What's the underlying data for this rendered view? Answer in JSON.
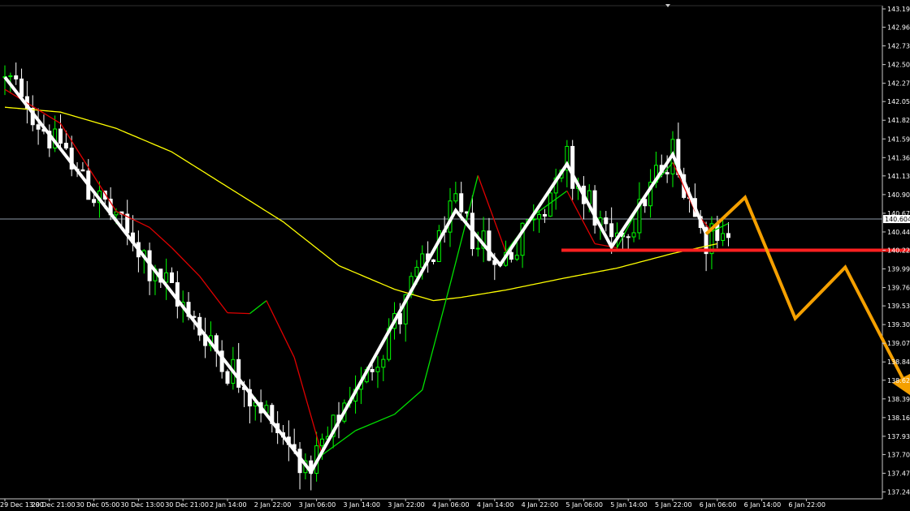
{
  "colors": {
    "background": "#000000",
    "frame": "#c8c8c8",
    "candle_up": "#00ff00",
    "candle_down": "#ffffff",
    "ma_slow": "#ffff00",
    "ma_fast_up": "#00e000",
    "ma_fast_down": "#e00000",
    "zigzag": "#ffffff",
    "neckline": "#ff2020",
    "projection": "#f5a000",
    "price_line": "#8e9aa8"
  },
  "chart_data": {
    "type": "candlestick",
    "title": "",
    "xlabel": "",
    "ylabel": "",
    "ylim": [
      137.16,
      143.23
    ],
    "grid": false,
    "y_ticks": [
      "143.190",
      "142.965",
      "142.735",
      "142.505",
      "142.275",
      "142.050",
      "141.820",
      "141.590",
      "141.360",
      "141.135",
      "140.905",
      "140.675",
      "140.445",
      "140.220",
      "139.990",
      "139.760",
      "139.535",
      "139.305",
      "139.075",
      "138.845",
      "138.620",
      "138.390",
      "138.160",
      "137.930",
      "137.705",
      "137.475",
      "137.245"
    ],
    "x_ticks": [
      "29 Dec 13:00",
      "29 Dec 21:00",
      "30 Dec 05:00",
      "30 Dec 13:00",
      "30 Dec 21:00",
      "2 Jan 14:00",
      "2 Jan 22:00",
      "3 Jan 06:00",
      "3 Jan 14:00",
      "3 Jan 22:00",
      "4 Jan 06:00",
      "4 Jan 14:00",
      "4 Jan 22:00",
      "5 Jan 06:00",
      "5 Jan 14:00",
      "5 Jan 22:00",
      "6 Jan 06:00",
      "6 Jan 14:00",
      "6 Jan 22:00"
    ],
    "current_price": "140.604",
    "neckline_price": 140.22,
    "zigzag_pivots": [
      {
        "bar": 0,
        "price": 142.35
      },
      {
        "bar": 55,
        "price": 137.49
      },
      {
        "bar": 81,
        "price": 140.71
      },
      {
        "bar": 89,
        "price": 140.04
      },
      {
        "bar": 101,
        "price": 141.28
      },
      {
        "bar": 109,
        "price": 140.26
      },
      {
        "bar": 120,
        "price": 141.4
      },
      {
        "bar": 126,
        "price": 140.42
      }
    ],
    "projection_pivots": [
      {
        "bar": 126,
        "price": 140.42
      },
      {
        "bar": 133,
        "price": 140.87
      },
      {
        "bar": 142,
        "price": 139.38
      },
      {
        "bar": 151,
        "price": 140.01
      },
      {
        "bar": 163,
        "price": 138.42
      }
    ],
    "ma_slow_path": [
      {
        "bar": 0,
        "price": 141.98
      },
      {
        "bar": 10,
        "price": 141.92
      },
      {
        "bar": 20,
        "price": 141.72
      },
      {
        "bar": 30,
        "price": 141.43
      },
      {
        "bar": 40,
        "price": 141.0
      },
      {
        "bar": 50,
        "price": 140.57
      },
      {
        "bar": 60,
        "price": 140.03
      },
      {
        "bar": 70,
        "price": 139.74
      },
      {
        "bar": 77,
        "price": 139.6
      },
      {
        "bar": 82,
        "price": 139.64
      },
      {
        "bar": 90,
        "price": 139.73
      },
      {
        "bar": 100,
        "price": 139.87
      },
      {
        "bar": 110,
        "price": 140.0
      },
      {
        "bar": 120,
        "price": 140.18
      },
      {
        "bar": 128,
        "price": 140.3
      }
    ],
    "ma_fast_path": [
      {
        "bar": 0,
        "price": 142.2
      },
      {
        "bar": 10,
        "price": 141.78
      },
      {
        "bar": 20,
        "price": 140.7
      },
      {
        "bar": 26,
        "price": 140.5
      },
      {
        "bar": 30,
        "price": 140.25
      },
      {
        "bar": 35,
        "price": 139.9
      },
      {
        "bar": 40,
        "price": 139.45
      },
      {
        "bar": 44,
        "price": 139.44
      },
      {
        "bar": 47,
        "price": 139.6
      },
      {
        "bar": 52,
        "price": 138.9
      },
      {
        "bar": 57,
        "price": 137.7
      },
      {
        "bar": 63,
        "price": 138.0
      },
      {
        "bar": 70,
        "price": 138.2
      },
      {
        "bar": 75,
        "price": 138.5
      },
      {
        "bar": 80,
        "price": 139.8
      },
      {
        "bar": 85,
        "price": 141.14
      },
      {
        "bar": 90,
        "price": 140.2
      },
      {
        "bar": 95,
        "price": 140.65
      },
      {
        "bar": 101,
        "price": 140.95
      },
      {
        "bar": 106,
        "price": 140.3
      },
      {
        "bar": 110,
        "price": 140.25
      },
      {
        "bar": 115,
        "price": 140.9
      },
      {
        "bar": 120,
        "price": 141.3
      },
      {
        "bar": 124,
        "price": 140.7
      },
      {
        "bar": 127,
        "price": 140.45
      },
      {
        "bar": 130,
        "price": 140.55
      }
    ]
  }
}
